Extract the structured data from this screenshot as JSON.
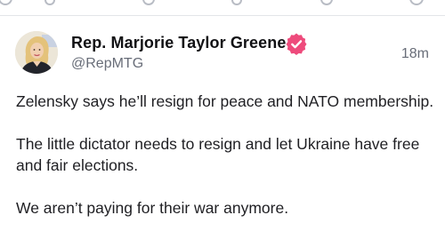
{
  "post": {
    "author": {
      "display_name": "Rep. Marjorie Taylor Greene",
      "handle": "@RepMTG",
      "verified": true,
      "avatar_icon": "profile-photo"
    },
    "timestamp": "18m",
    "paragraphs": [
      "Zelensky says he’ll resign for peace and NATO membership.",
      "The little dictator needs to resign and let Ukraine have free and fair elections.",
      "We aren’t paying for their war anymore."
    ]
  },
  "colors": {
    "verified_badge": "#ee4b7c",
    "secondary_text": "#686d78",
    "primary_text": "#1f1f23",
    "divider": "#e3e5e8"
  }
}
